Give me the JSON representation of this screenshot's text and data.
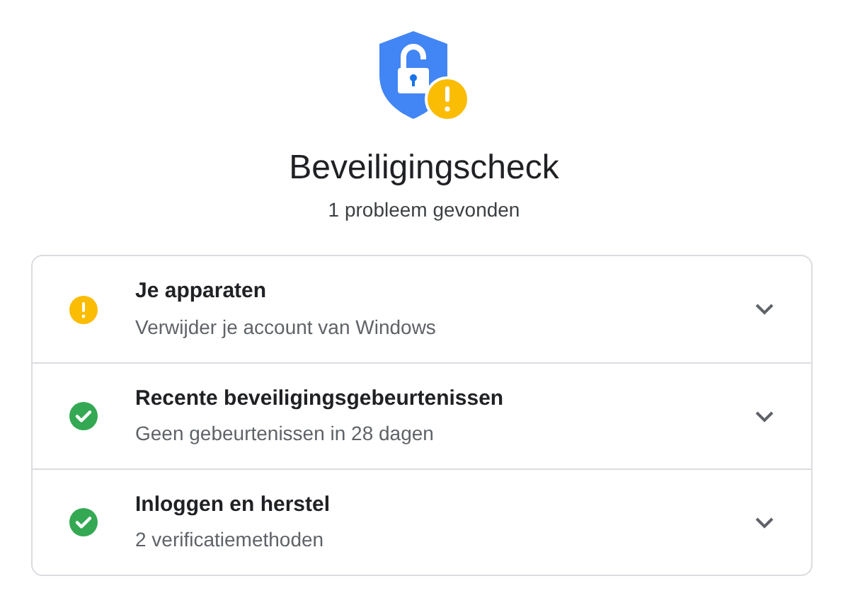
{
  "title": "Beveiligingscheck",
  "subtitle": "1 probleem gevonden",
  "items": [
    {
      "kind": "warning",
      "title": "Je apparaten",
      "description": "Verwijder je account van Windows",
      "expanded": false
    },
    {
      "kind": "ok",
      "title": "Recente beveiligingsgebeurtenissen",
      "description": "Geen gebeurtenissen in 28 dagen",
      "expanded": false
    },
    {
      "kind": "ok",
      "title": "Inloggen en herstel",
      "description": "2 verificatiemethoden",
      "expanded": false
    }
  ]
}
